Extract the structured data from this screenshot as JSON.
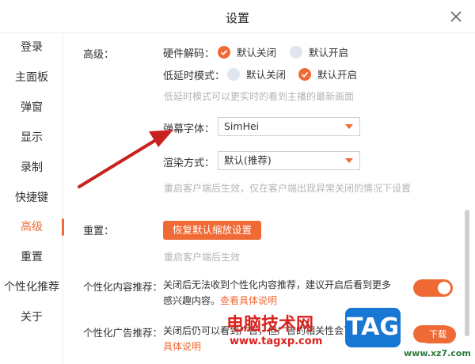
{
  "window": {
    "title": "设置"
  },
  "sidebar": {
    "items": [
      {
        "label": "登录"
      },
      {
        "label": "主面板"
      },
      {
        "label": "弹窗"
      },
      {
        "label": "显示"
      },
      {
        "label": "录制"
      },
      {
        "label": "快捷键"
      },
      {
        "label": "高级",
        "active": true
      },
      {
        "label": "重置"
      },
      {
        "label": "个性化推荐"
      },
      {
        "label": "关于"
      }
    ]
  },
  "advanced": {
    "heading": "高级：",
    "hardware_decode": {
      "label": "硬件解码：",
      "options": [
        "默认关闭",
        "默认开启"
      ],
      "selected": "默认关闭"
    },
    "low_latency": {
      "label": "低延时模式：",
      "options": [
        "默认关闭",
        "默认开启"
      ],
      "selected": "默认开启",
      "hint": "低延时模式可以更实时的看到主播的最新画面"
    },
    "danmaku_font": {
      "label": "弹幕字体：",
      "value": "SimHei"
    },
    "render_mode": {
      "label": "渲染方式：",
      "value": "默认(推荐)",
      "hint": "重启客户端后生效，仅在客户端出现异常关闭的情况下设置"
    }
  },
  "reset": {
    "heading": "重置：",
    "button_label": "恢复默认缩放设置",
    "hint": "重启客户端后生效"
  },
  "personalized_content": {
    "label": "个性化内容推荐：",
    "desc": "关闭后无法收到个性化内容推荐，建议开启后看到更多感兴趣内容。",
    "link": "查看具体说明",
    "enabled": true
  },
  "personalized_ads": {
    "label": "个性化广告推荐：",
    "desc": "关闭后仍可以看到广告，但广告的相关性会下降。",
    "link": "查看具体说明",
    "enabled": true
  },
  "watermark": {
    "site_name": "电脑技术网",
    "site_url": "www.tagxp.com",
    "logo_text": "TAG",
    "secondary_url": "www.xz7.com",
    "secondary_badge": "下载"
  },
  "colors": {
    "accent": "#f06a35",
    "radio_off": "#dfe6ee",
    "hint": "#b4b4b4",
    "annotation_arrow": "#c8211e"
  }
}
